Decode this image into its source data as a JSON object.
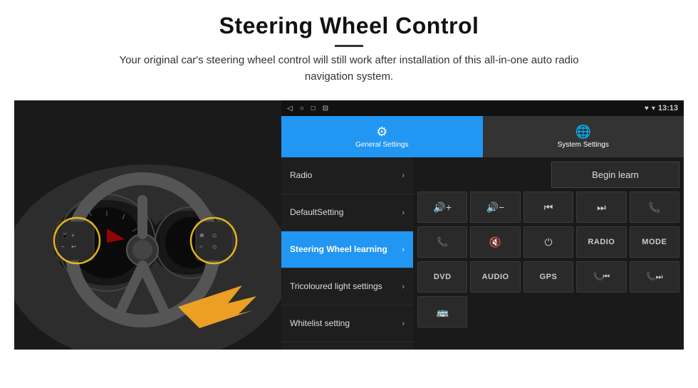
{
  "header": {
    "title": "Steering Wheel Control",
    "subtitle": "Your original car's steering wheel control will still work after installation of this all-in-one auto radio navigation system."
  },
  "status_bar": {
    "nav_icons": [
      "◁",
      "○",
      "□",
      "⊟"
    ],
    "status_icons": [
      "♥",
      "▾"
    ],
    "time": "13:13"
  },
  "tabs": [
    {
      "id": "general",
      "label": "General Settings",
      "active": true
    },
    {
      "id": "system",
      "label": "System Settings",
      "active": false
    }
  ],
  "settings_items": [
    {
      "id": "radio",
      "label": "Radio",
      "active": false
    },
    {
      "id": "default",
      "label": "DefaultSetting",
      "active": false
    },
    {
      "id": "steering",
      "label": "Steering Wheel learning",
      "active": true
    },
    {
      "id": "tricoloured",
      "label": "Tricoloured light settings",
      "active": false
    },
    {
      "id": "whitelist",
      "label": "Whitelist setting",
      "active": false
    }
  ],
  "controls": {
    "begin_learn_label": "Begin learn",
    "row1": [
      "🔊+",
      "🔊−",
      "⏮",
      "⏭",
      "📞"
    ],
    "row2": [
      "📞",
      "🔇",
      "⏻",
      "RADIO",
      "MODE"
    ],
    "row3": [
      "DVD",
      "AUDIO",
      "GPS",
      "📞⏮",
      "📞⏭"
    ],
    "row4": [
      "🚌"
    ]
  }
}
